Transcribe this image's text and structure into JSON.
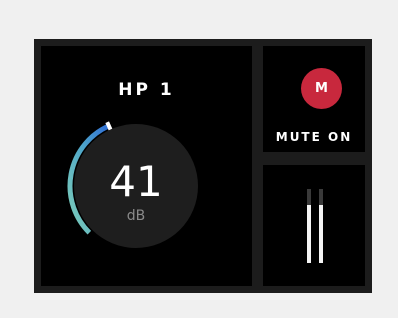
{
  "channel": {
    "title": "HP 1"
  },
  "volume": {
    "value": "41",
    "unit": "dB",
    "level_fraction": 0.41
  },
  "mute": {
    "button_label": "M",
    "status_label": "MUTE ON",
    "button_color": "#c8283d"
  },
  "meter": {
    "left_level_fraction": 0.78,
    "right_level_fraction": 0.78
  },
  "colors": {
    "background": "#f0f0f0",
    "device_frame": "#1c1c1c",
    "panel": "#000000",
    "arc_start": "#7fcfb8",
    "arc_end": "#2f6ed6",
    "knob_face": "#1e1e1e"
  }
}
